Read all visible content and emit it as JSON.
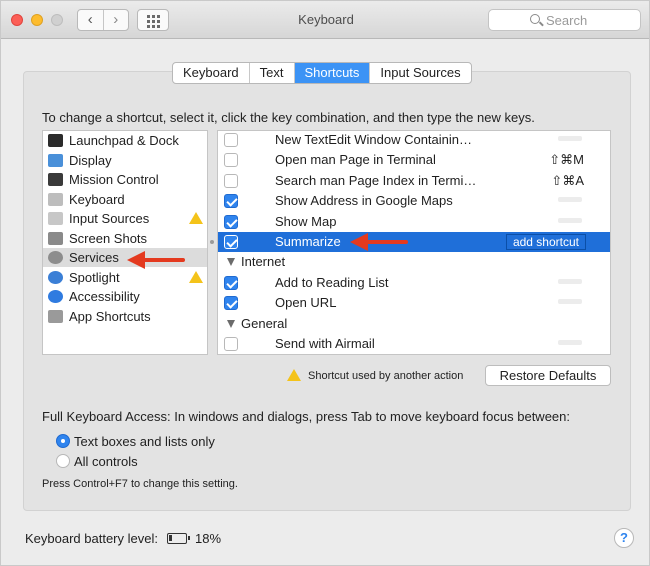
{
  "window": {
    "title": "Keyboard",
    "nav_back": "‹",
    "nav_forward": "›",
    "search_placeholder": "Search"
  },
  "tabs": [
    {
      "label": "Keyboard",
      "active": false
    },
    {
      "label": "Text",
      "active": false
    },
    {
      "label": "Shortcuts",
      "active": true
    },
    {
      "label": "Input Sources",
      "active": false
    }
  ],
  "instructions": "To change a shortcut, select it, click the key combination, and then type the new keys.",
  "categories": [
    {
      "label": "Launchpad & Dock",
      "icon": "launchpad-icon",
      "color": "#2b2b2b",
      "warning": false,
      "selected": false
    },
    {
      "label": "Display",
      "icon": "display-icon",
      "color": "#4a90d9",
      "warning": false,
      "selected": false
    },
    {
      "label": "Mission Control",
      "icon": "mission-control-icon",
      "color": "#3a3a3a",
      "warning": false,
      "selected": false
    },
    {
      "label": "Keyboard",
      "icon": "keyboard-icon",
      "color": "#bdbdbd",
      "warning": false,
      "selected": false
    },
    {
      "label": "Input Sources",
      "icon": "input-sources-icon",
      "color": "#c7c7c7",
      "warning": true,
      "selected": false
    },
    {
      "label": "Screen Shots",
      "icon": "screenshot-icon",
      "color": "#8a8a8a",
      "warning": false,
      "selected": false
    },
    {
      "label": "Services",
      "icon": "gear-icon",
      "color": "#8d8d8d",
      "warning": false,
      "selected": true
    },
    {
      "label": "Spotlight",
      "icon": "spotlight-icon",
      "color": "#3b7fd6",
      "warning": true,
      "selected": false
    },
    {
      "label": "Accessibility",
      "icon": "accessibility-icon",
      "color": "#2f7be0",
      "warning": false,
      "selected": false
    },
    {
      "label": "App Shortcuts",
      "icon": "app-shortcuts-icon",
      "color": "#9a9a9a",
      "warning": false,
      "selected": false
    }
  ],
  "shortcuts": [
    {
      "label": "New TextEdit Window Containin…",
      "checked": false,
      "keys": "",
      "none": true
    },
    {
      "label": "Open man Page in Terminal",
      "checked": false,
      "keys": "⇧⌘M"
    },
    {
      "label": "Search man Page Index in Termi…",
      "checked": false,
      "keys": "⇧⌘A"
    },
    {
      "label": "Show Address in Google Maps",
      "checked": true,
      "keys": "",
      "none": true
    },
    {
      "label": "Show Map",
      "checked": true,
      "keys": "",
      "none": true
    },
    {
      "label": "Summarize",
      "checked": true,
      "selected": true,
      "add": "add shortcut"
    },
    {
      "group": "Internet"
    },
    {
      "label": "Add to Reading List",
      "checked": true,
      "keys": "",
      "none": true
    },
    {
      "label": "Open URL",
      "checked": true,
      "keys": "",
      "none": true
    },
    {
      "group": "General"
    },
    {
      "label": "Send with Airmail",
      "checked": false,
      "keys": "",
      "none": true
    }
  ],
  "legend": "Shortcut used by another action",
  "restore_defaults": "Restore Defaults",
  "full_keyboard_access": "Full Keyboard Access: In windows and dialogs, press Tab to move keyboard focus between:",
  "fka_options": [
    {
      "label": "Text boxes and lists only",
      "selected": true
    },
    {
      "label": "All controls",
      "selected": false
    }
  ],
  "fka_note": "Press Control+F7 to change this setting.",
  "battery": {
    "label": "Keyboard battery level:",
    "value": "18%",
    "percent": 18
  },
  "help": "?",
  "colors": {
    "accent": "#2f84ee",
    "selection": "#1f6fd9",
    "warning": "#f4c31a",
    "annotation_arrow": "#e43a1f"
  }
}
